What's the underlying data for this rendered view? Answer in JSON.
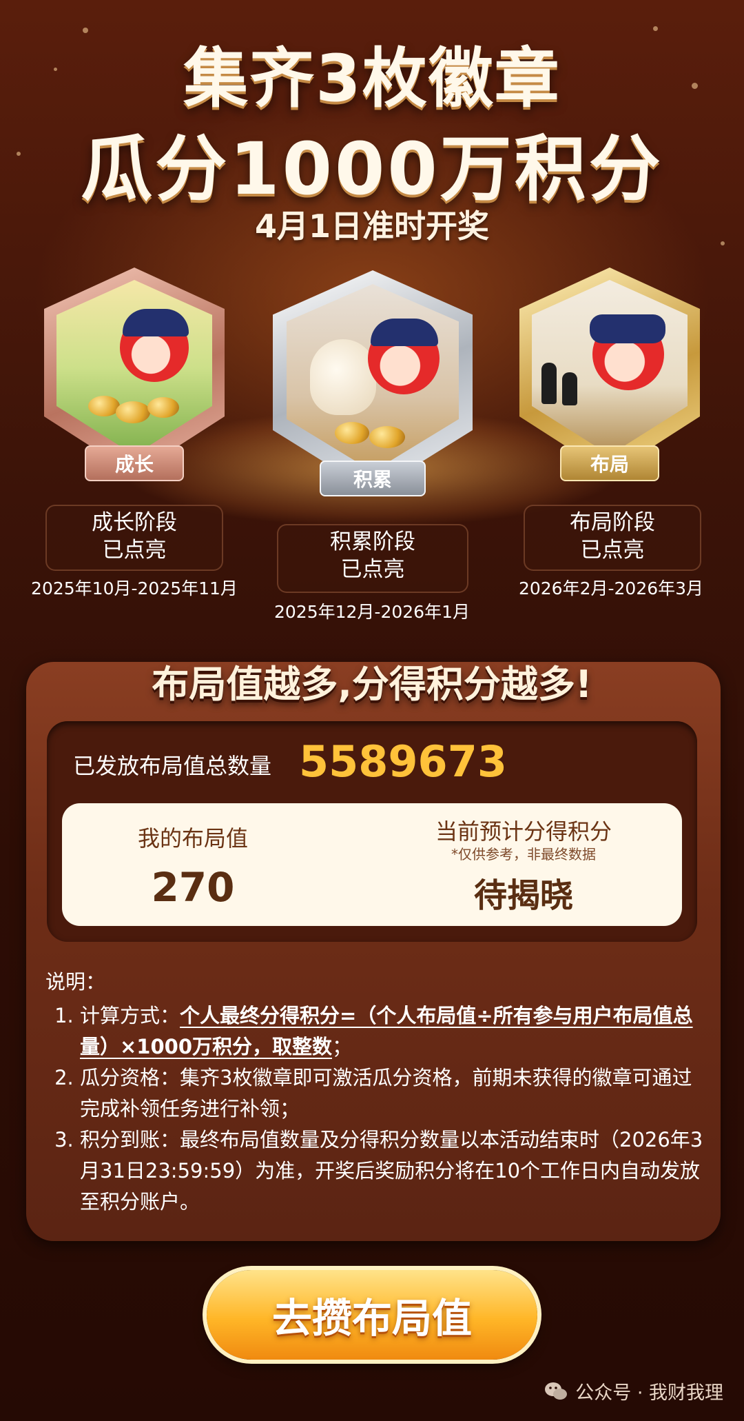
{
  "header": {
    "title_line1": "集齐3枚徽章",
    "title_line2": "瓜分1000万积分",
    "subtitle": "4月1日准时开奖"
  },
  "badges": [
    {
      "ribbon": "成长",
      "stage": "成长阶段",
      "status": "已点亮",
      "dates": "2025年10月-2025年11月",
      "metal": "#d89a86"
    },
    {
      "ribbon": "积累",
      "stage": "积累阶段",
      "status": "已点亮",
      "dates": "2025年12月-2026年1月",
      "metal": "#cfd3d9"
    },
    {
      "ribbon": "布局",
      "stage": "布局阶段",
      "status": "已点亮",
      "dates": "2026年2月-2026年3月",
      "metal": "#e6c476"
    }
  ],
  "panel": {
    "heading": "布局值越多,分得积分越多!",
    "total_label": "已发放布局值总数量",
    "total_value": "5589673",
    "my_label": "我的布局值",
    "my_value": "270",
    "estimate_label": "当前预计分得积分",
    "estimate_note": "*仅供参考，非最终数据",
    "estimate_value": "待揭晓"
  },
  "explain": {
    "heading": "说明：",
    "item1_prefix": "计算方式：",
    "item1_formula": "个人最终分得积分=（个人布局值÷所有参与用户布局值总量）×1000万积分，取整数",
    "item1_suffix": "；",
    "item2": "瓜分资格：集齐3枚徽章即可激活瓜分资格，前期未获得的徽章可通过完成补领任务进行补领；",
    "item3": "积分到账：最终布局值数量及分得积分数量以本活动结束时（2026年3月31日23:59:59）为准，开奖后奖励积分将在10个工作日内自动发放至积分账户。"
  },
  "cta": {
    "label": "去攒布局值"
  },
  "footer": {
    "text": "公众号 · 我财我理",
    "icon": "wechat-icon"
  }
}
